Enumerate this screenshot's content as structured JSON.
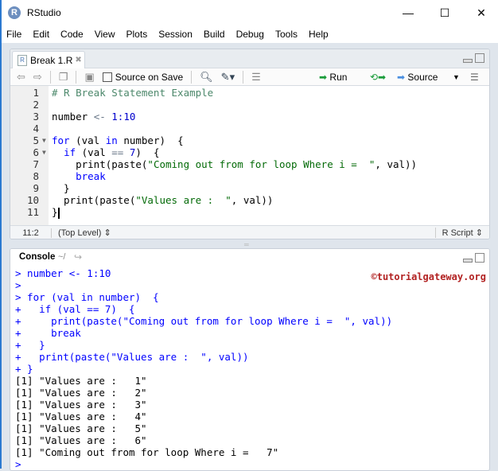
{
  "window": {
    "title": "RStudio",
    "minimize": "—",
    "maximize": "☐",
    "close": "✕"
  },
  "menu": [
    "File",
    "Edit",
    "Code",
    "View",
    "Plots",
    "Session",
    "Build",
    "Debug",
    "Tools",
    "Help"
  ],
  "editor": {
    "tab_label": "Break 1.R",
    "source_on_save": "Source on Save",
    "run_label": "Run",
    "source_label": "Source",
    "lines": [
      [
        [
          "c",
          "# R Break Statement Example"
        ]
      ],
      [],
      [
        [
          "p",
          "number "
        ],
        [
          "o",
          "<-"
        ],
        [
          "n",
          " 1:10"
        ]
      ],
      [],
      [
        [
          "k",
          "for"
        ],
        [
          "p",
          " (val "
        ],
        [
          "k",
          "in"
        ],
        [
          "p",
          " number)  "
        ],
        [
          "p",
          "{"
        ]
      ],
      [
        [
          "p",
          "  "
        ],
        [
          "k",
          "if"
        ],
        [
          "p",
          " (val "
        ],
        [
          "o",
          "=="
        ],
        [
          "n",
          " 7"
        ],
        [
          "p",
          ")  {"
        ]
      ],
      [
        [
          "p",
          "    print(paste("
        ],
        [
          "s",
          "\"Coming out from for loop Where i =  \""
        ],
        [
          "p",
          ", val))"
        ]
      ],
      [
        [
          "p",
          "    "
        ],
        [
          "k",
          "break"
        ]
      ],
      [
        [
          "p",
          "  }"
        ]
      ],
      [
        [
          "p",
          "  print(paste("
        ],
        [
          "s",
          "\"Values are :  \""
        ],
        [
          "p",
          ", val))"
        ]
      ],
      [
        [
          "p",
          "}"
        ]
      ]
    ],
    "folds": [
      5,
      6
    ],
    "cursor_position": "11:2",
    "scope": "(Top Level)",
    "file_type": "R Script"
  },
  "console": {
    "title": "Console",
    "path": "~/",
    "watermark": "©tutorialgateway.org",
    "lines": [
      [
        "in",
        "> number <- 1:10"
      ],
      [
        "in",
        ">"
      ],
      [
        "in",
        "> for (val in number)  {"
      ],
      [
        "in",
        "+   if (val == 7)  {"
      ],
      [
        "in",
        "+     print(paste(\"Coming out from for loop Where i =  \", val))"
      ],
      [
        "in",
        "+     break"
      ],
      [
        "in",
        "+   }"
      ],
      [
        "in",
        "+   print(paste(\"Values are :  \", val))"
      ],
      [
        "in",
        "+ }"
      ],
      [
        "out",
        "[1] \"Values are :   1\""
      ],
      [
        "out",
        "[1] \"Values are :   2\""
      ],
      [
        "out",
        "[1] \"Values are :   3\""
      ],
      [
        "out",
        "[1] \"Values are :   4\""
      ],
      [
        "out",
        "[1] \"Values are :   5\""
      ],
      [
        "out",
        "[1] \"Values are :   6\""
      ],
      [
        "out",
        "[1] \"Coming out from for loop Where i =   7\""
      ],
      [
        "in",
        ">"
      ]
    ]
  }
}
